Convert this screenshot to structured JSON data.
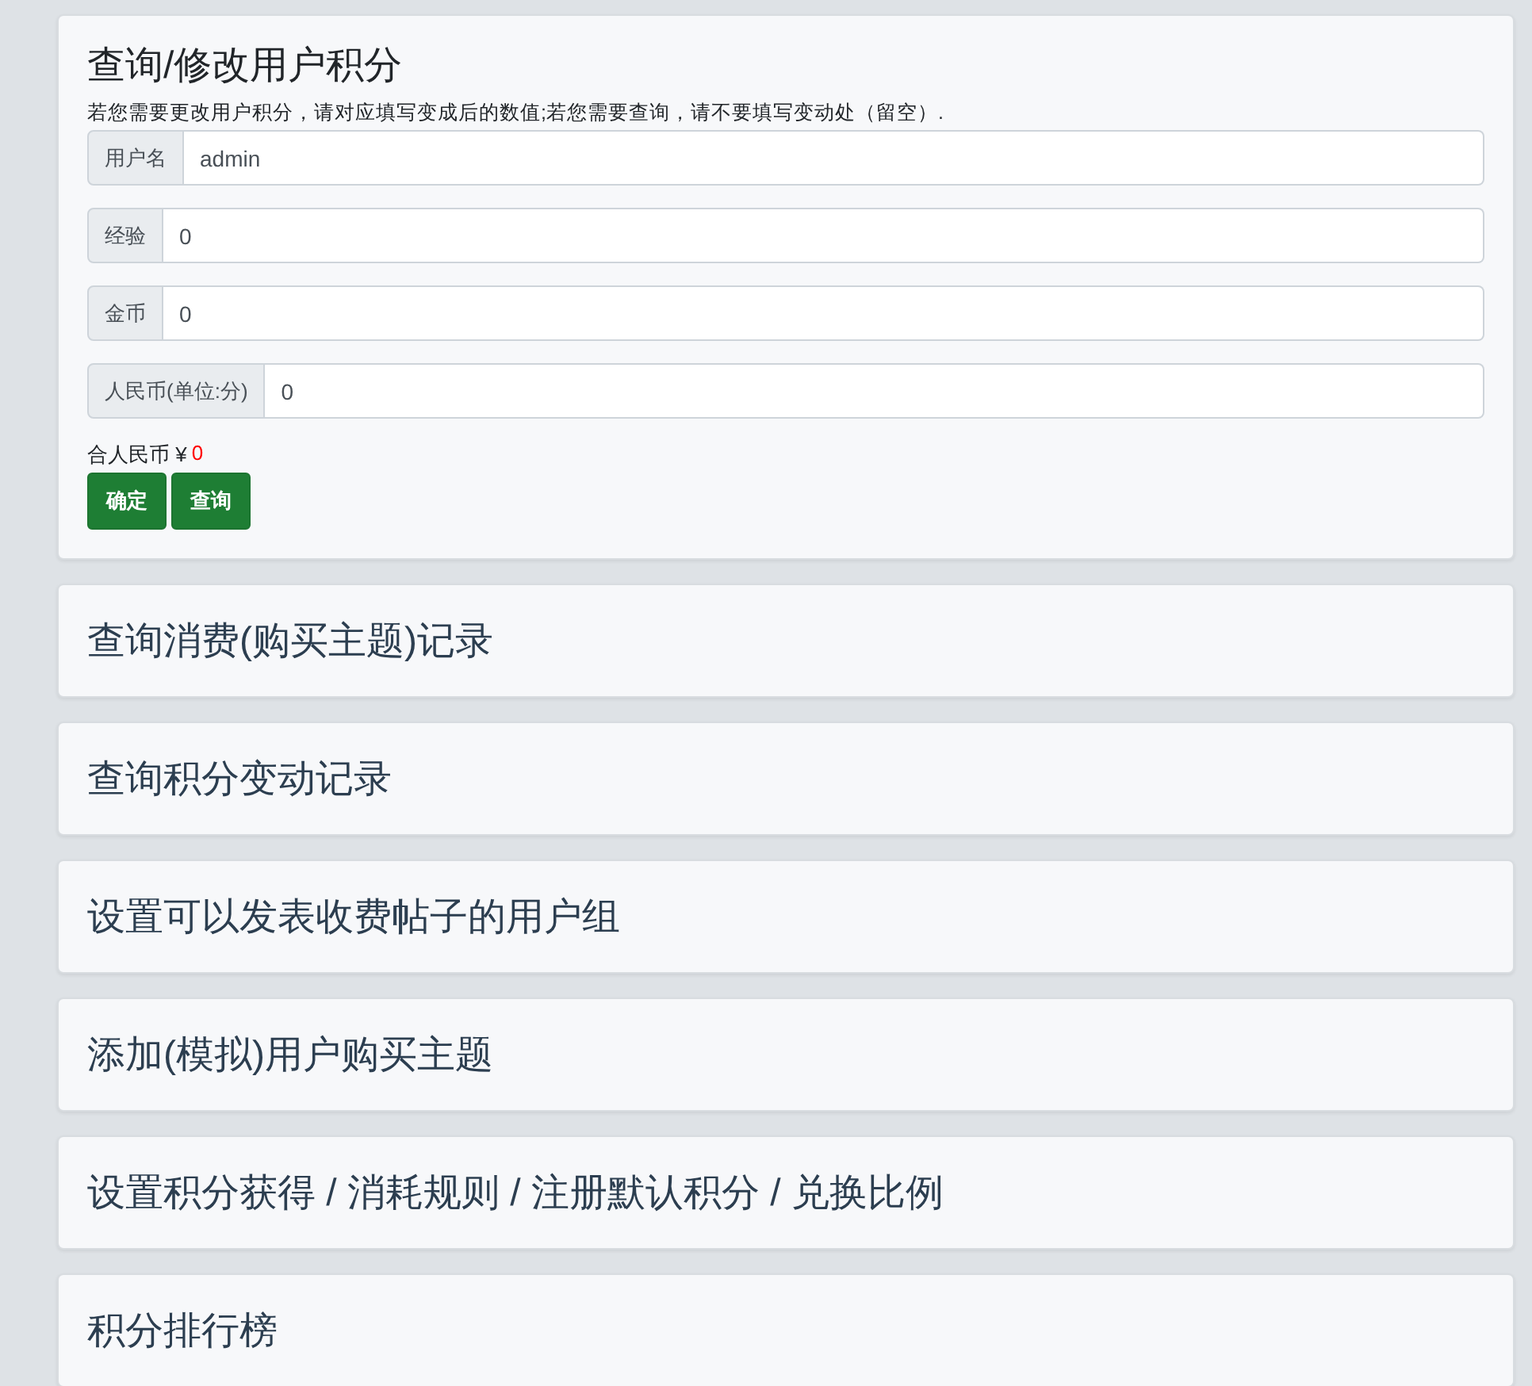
{
  "main_panel": {
    "title": "查询/修改用户积分",
    "hint": "若您需要更改用户积分，请对应填写变成后的数值;若您需要查询，请不要填写变动处（留空）.",
    "fields": [
      {
        "label": "用户名",
        "value": "admin"
      },
      {
        "label": "经验",
        "value": "0"
      },
      {
        "label": "金币",
        "value": "0"
      },
      {
        "label": "人民币(单位:分)",
        "value": "0"
      }
    ],
    "total": {
      "label": "合人民币 ¥",
      "value": "0"
    },
    "buttons": [
      "确定",
      "查询"
    ]
  },
  "panels": [
    {
      "title": "查询消费(购买主题)记录"
    },
    {
      "title": "查询积分变动记录"
    },
    {
      "title": "设置可以发表收费帖子的用户组"
    },
    {
      "title": "添加(模拟)用户购买主题"
    },
    {
      "title": "设置积分获得 / 消耗规则 / 注册默认积分 / 兑换比例"
    },
    {
      "title": "积分排行榜"
    }
  ]
}
